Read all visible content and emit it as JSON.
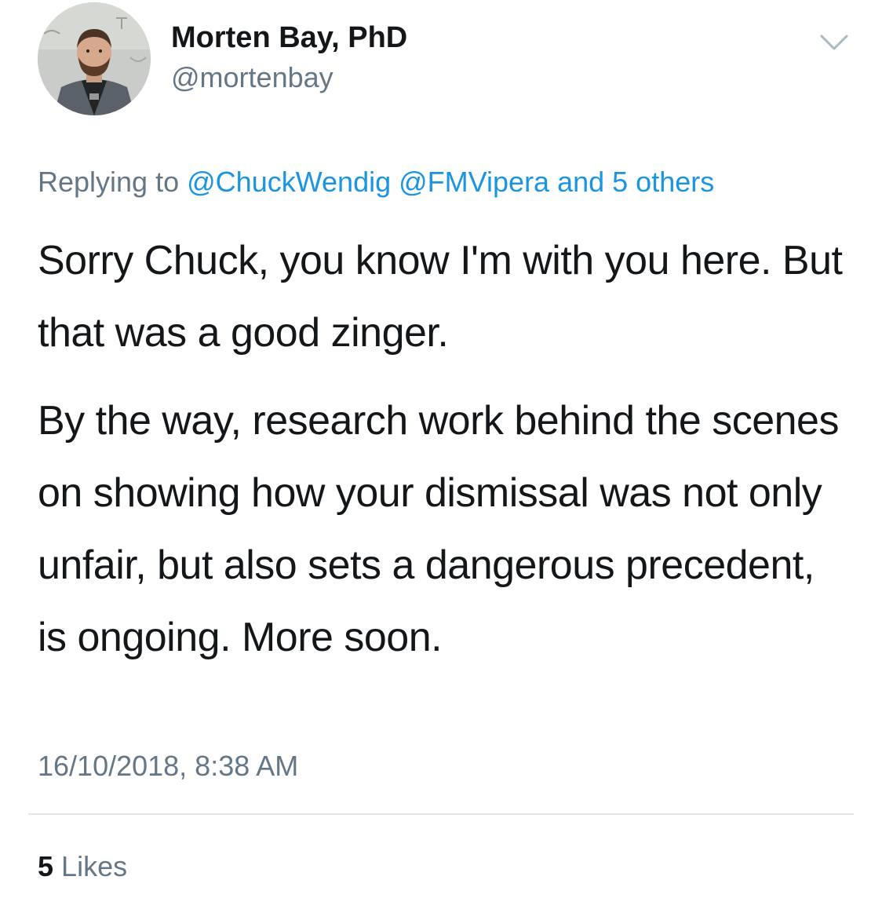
{
  "author": {
    "name": "Morten Bay, PhD",
    "handle": "@mortenbay"
  },
  "reply": {
    "prefix": "Replying to",
    "mention_1": "@ChuckWendig",
    "mention_2": "@FMVipera",
    "others": "and 5 others"
  },
  "body": {
    "paragraph_1": "Sorry Chuck, you know I'm with you here. But that was a good zinger.",
    "paragraph_2": "By the way, research work behind the scenes on showing how your dismissal was not only unfair, but also sets a dangerous precedent, is ongoing. More soon."
  },
  "timestamp": "16/10/2018, 8:38 AM",
  "stats": {
    "likes_count": "5",
    "likes_label": "Likes"
  },
  "colors": {
    "text_primary": "#14171a",
    "text_secondary": "#657786",
    "link": "#1b95e0",
    "divider": "#e1e8ed"
  },
  "icons": {
    "menu": "chevron-down-icon"
  }
}
